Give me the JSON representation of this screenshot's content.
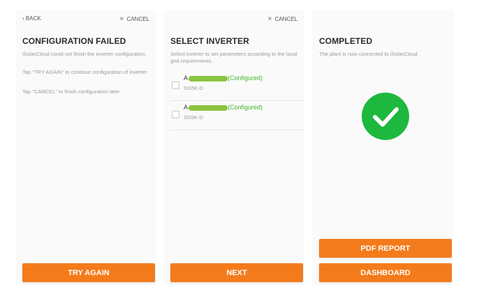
{
  "panel1": {
    "back_label": "BACK",
    "cancel_label": "CANCEL",
    "title": "CONFIGURATION FAILED",
    "desc1": "iSolarCloud could not finish the inverter configuration.",
    "desc2": "Tap \"TRY AGAIN\" to continue configuration of inverter.",
    "desc3": "Tap \"CANCEL\" to finish configuration later.",
    "button_label": "TRY AGAIN"
  },
  "panel2": {
    "cancel_label": "CANCEL",
    "title": "SELECT INVERTER",
    "desc": "Select inverter to set parameters according to the local grid requirements.",
    "inverters": [
      {
        "name_prefix": "A",
        "status": "(Configured)",
        "model": "SG5K-D",
        "checked": false
      },
      {
        "name_prefix": "A",
        "status": "(Configured)",
        "model": "SG5K-D",
        "checked": false
      }
    ],
    "button_label": "NEXT"
  },
  "panel3": {
    "title": "COMPLETED",
    "desc": "The plant is now connected to iSolarCloud.",
    "pdf_button_label": "PDF REPORT",
    "dashboard_button_label": "DASHBOARD"
  },
  "colors": {
    "accent": "#f47b1b",
    "success": "#1db83e",
    "configured_text": "#44b62b",
    "panel_bg": "#fafafa"
  },
  "icons": {
    "cancel": "close-icon",
    "back": "chevron-left-icon",
    "completed": "check-circle-icon"
  }
}
